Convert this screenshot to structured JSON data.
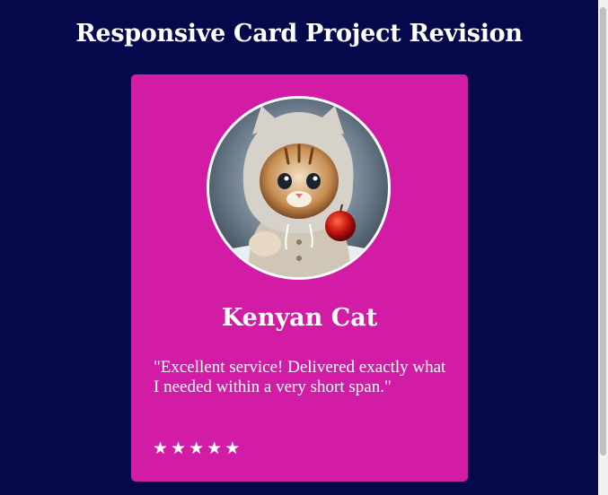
{
  "page": {
    "title": "Responsive Card Project Revision",
    "background_color": "#05084a"
  },
  "card": {
    "background_color": "#d21ca6",
    "avatar": {
      "icon": "kitten-in-hoodie-photo"
    },
    "name": "Kenyan Cat",
    "quote": "\"Excellent service! Delivered exactly what I needed within a very short span.\"",
    "rating": {
      "stars": [
        "★",
        "★",
        "★",
        "★",
        "★"
      ],
      "value": 5,
      "max": 5
    }
  }
}
